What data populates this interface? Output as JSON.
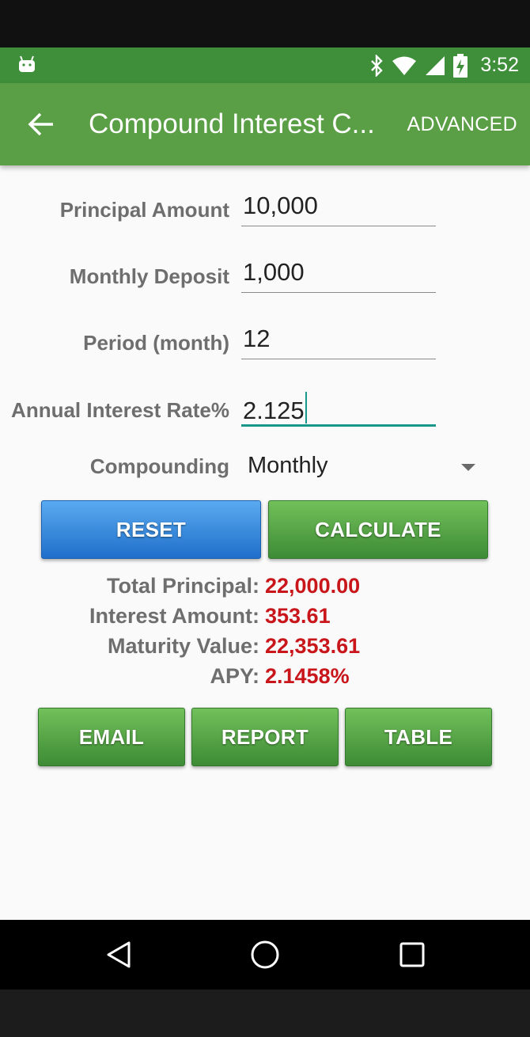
{
  "status_bar": {
    "time": "3:52",
    "icons": [
      "android-debug-icon",
      "bluetooth-icon",
      "wifi-icon",
      "cell-signal-icon",
      "battery-charging-icon"
    ]
  },
  "app_bar": {
    "title": "Compound Interest C...",
    "action": "ADVANCED"
  },
  "form": {
    "principal": {
      "label": "Principal Amount",
      "value": "10,000"
    },
    "deposit": {
      "label": "Monthly Deposit",
      "value": "1,000"
    },
    "period": {
      "label": "Period (month)",
      "value": "12"
    },
    "rate": {
      "label": "Annual Interest Rate%",
      "value": "2.125"
    },
    "compounding": {
      "label": "Compounding",
      "value": "Monthly"
    }
  },
  "buttons": {
    "reset": "RESET",
    "calculate": "CALCULATE",
    "email": "EMAIL",
    "report": "REPORT",
    "table": "TABLE"
  },
  "results": {
    "total_principal": {
      "label": "Total Principal:",
      "value": "22,000.00"
    },
    "interest_amount": {
      "label": "Interest Amount:",
      "value": "353.61"
    },
    "maturity_value": {
      "label": "Maturity Value:",
      "value": "22,353.61"
    },
    "apy": {
      "label": "APY:",
      "value": "2.1458%"
    }
  },
  "colors": {
    "app_bar": "#5a9e45",
    "status_bar": "#3f8f3a",
    "result_value": "#c8161b",
    "focus_accent": "#17968a",
    "reset_button": "#2f86dc",
    "green_button": "#55a548"
  }
}
